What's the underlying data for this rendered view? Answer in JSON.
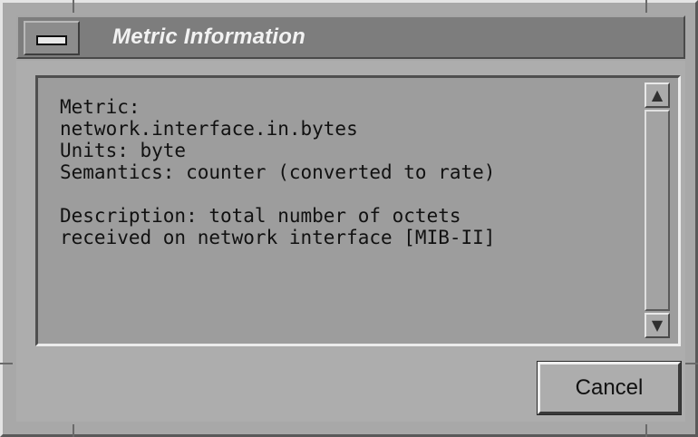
{
  "window": {
    "title": "Metric Information"
  },
  "panel": {
    "lines": [
      "Metric:",
      "network.interface.in.bytes",
      "Units: byte",
      "Semantics: counter (converted to rate)",
      "",
      "Description: total number of octets",
      "received on network interface [MIB-II]"
    ]
  },
  "icons": {
    "window_menu": "window-menu-icon",
    "scroll_up": "arrow-up-icon",
    "scroll_down": "arrow-down-icon"
  },
  "buttons": {
    "cancel": "Cancel"
  },
  "colors": {
    "frame": "#a8a8a8",
    "titlebar": "#7d7d7d",
    "panel": "#9d9d9d",
    "title_text": "#f2f2f2"
  }
}
